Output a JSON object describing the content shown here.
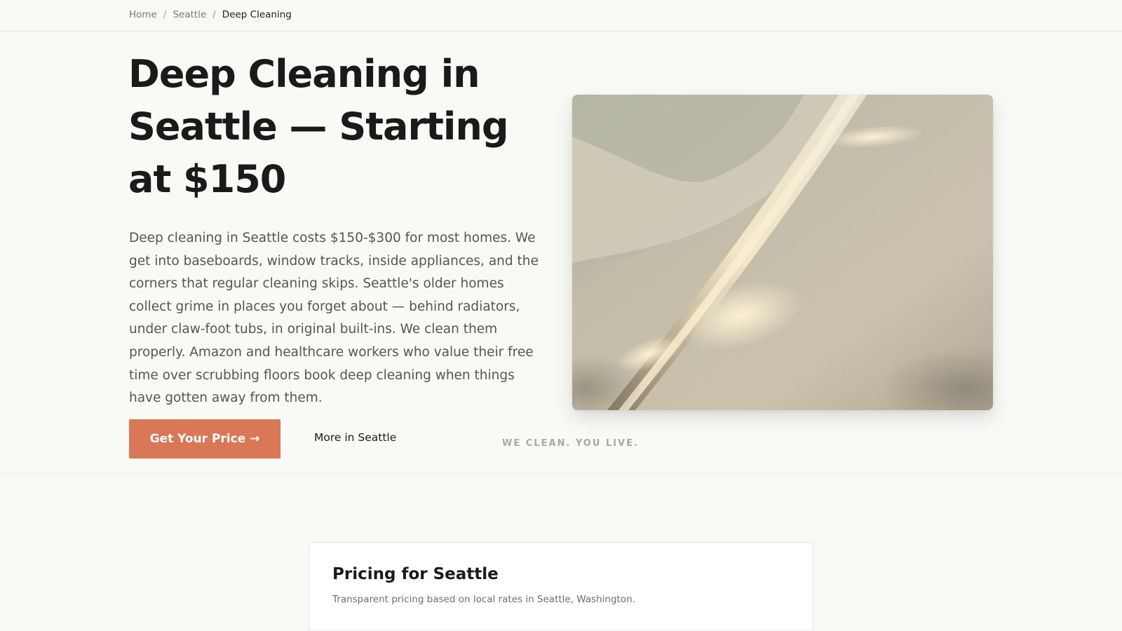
{
  "breadcrumb": {
    "items": [
      "Home",
      "Seattle"
    ],
    "separator": "/",
    "current": "Deep Cleaning"
  },
  "hero": {
    "title": "Deep Cleaning in Seattle — Starting at $150",
    "body": "Deep cleaning in Seattle costs $150-$300 for most homes. We get into baseboards, window tracks, inside appliances, and the corners that regular cleaning skips. Seattle's older homes collect grime in places you forget about — behind radiators, under claw-foot tubs, in original built-ins. We clean them properly. Amazon and healthcare workers who value their free time over scrubbing floors book deep cleaning when things have gotten away from them.",
    "cta_label": "Get Your Price →",
    "secondary_link": "More in Seattle",
    "tagline": "WE CLEAN. YOU LIVE."
  },
  "pricing": {
    "title": "Pricing for Seattle",
    "subtitle": "Transparent pricing based on local rates in Seattle, Washington."
  },
  "colors": {
    "accent": "#d97757",
    "background": "#f9f9f6",
    "text": "#1c1c1c",
    "muted": "#555552"
  }
}
